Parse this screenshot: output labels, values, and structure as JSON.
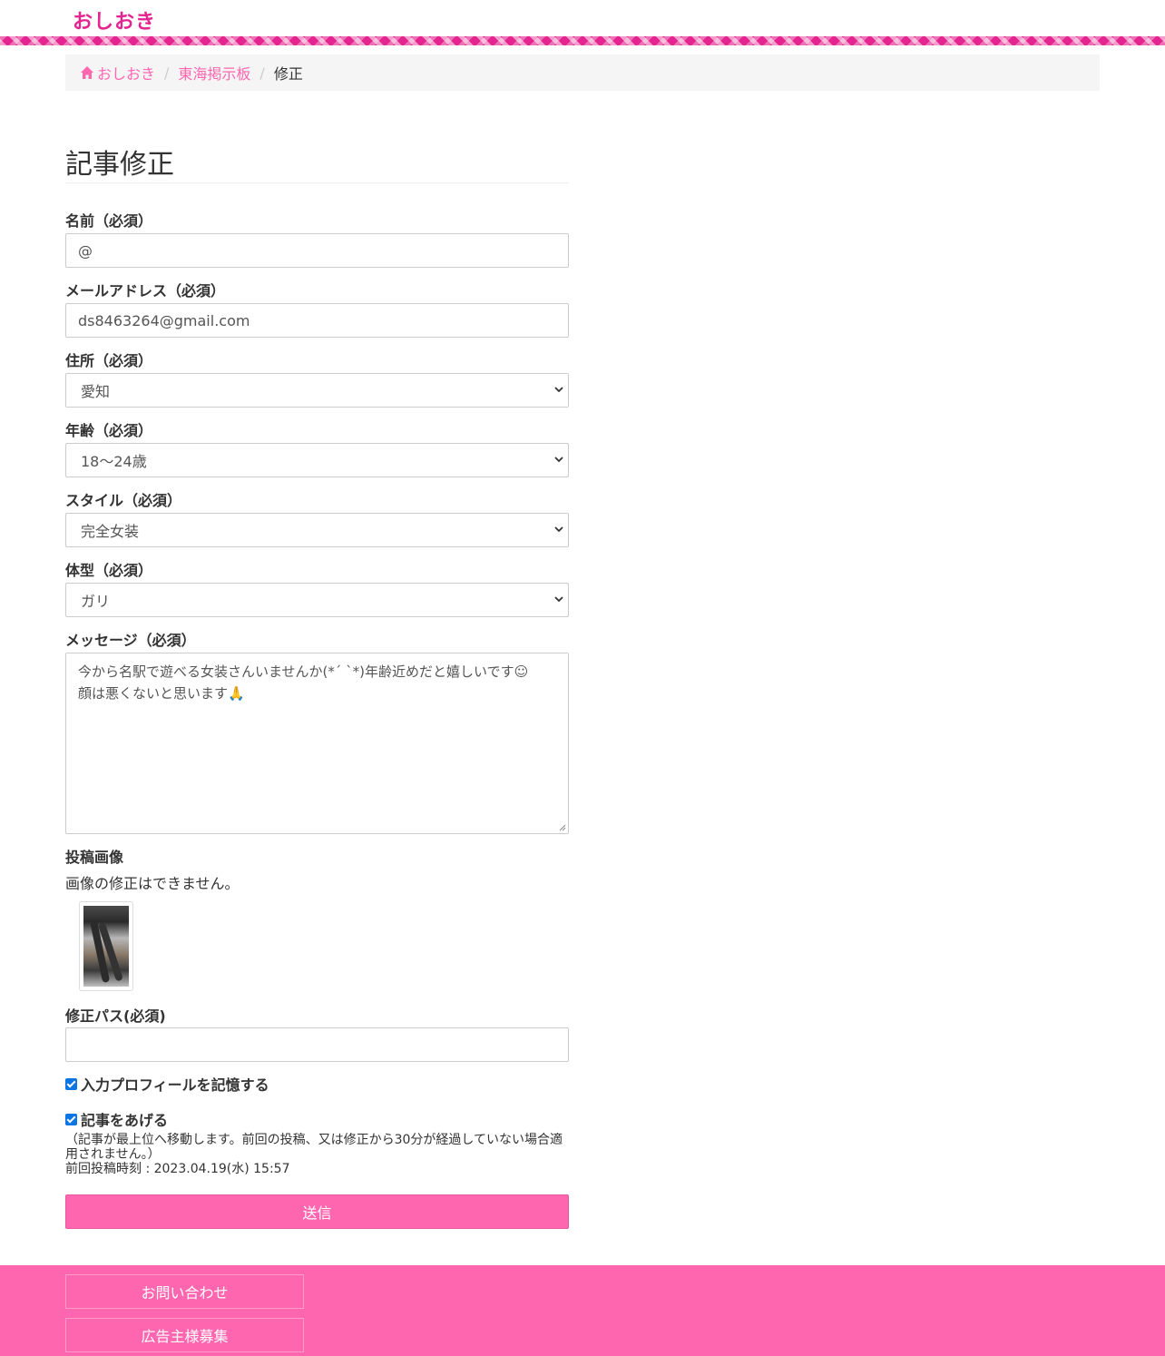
{
  "header": {
    "logo": "おしおき"
  },
  "breadcrumb": {
    "home": "おしおき",
    "board": "東海掲示板",
    "current": "修正"
  },
  "form": {
    "title": "記事修正",
    "name_label": "名前（必須）",
    "name_value": "@",
    "email_label": "メールアドレス（必須）",
    "email_value": "ds8463264@gmail.com",
    "address_label": "住所（必須）",
    "address_value": "愛知",
    "age_label": "年齢（必須）",
    "age_value": "18〜24歳",
    "style_label": "スタイル（必須）",
    "style_value": "完全女装",
    "body_label": "体型（必須）",
    "body_value": "ガリ",
    "message_label": "メッセージ（必須）",
    "message_line1": "今から名駅で遊べる女装さんいませんか(*´ `*)年齢近めだと嬉しいです☺",
    "message_line2": "顔は悪くないと思います🙏",
    "image_label": "投稿画像",
    "image_note": "画像の修正はできません。",
    "password_label": "修正パス(必須)",
    "password_value": "",
    "remember_label": "入力プロフィールを記憶する",
    "raise_label": "記事をあげる",
    "raise_note1": "（記事が最上位へ移動します。前回の投稿、又は修正から30分が経過していない場合適",
    "raise_note2": "用されません。）",
    "last_post": "前回投稿時刻 : 2023.04.19(水) 15:57",
    "submit_label": "送信"
  },
  "footer": {
    "contact": "お問い合わせ",
    "ads": "広告主様募集"
  },
  "colors": {
    "brand": "#e4258f",
    "accent": "#ff66b0",
    "checkbox": "#0a75e3"
  },
  "icons": {
    "home": "home-icon",
    "chevron": "chevron-down-icon"
  }
}
